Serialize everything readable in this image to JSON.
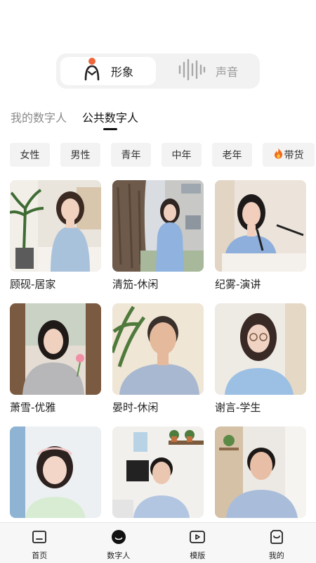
{
  "segment": {
    "image_label": "形象",
    "voice_label": "声音"
  },
  "tabs": [
    {
      "label": "我的数字人",
      "active": false
    },
    {
      "label": "公共数字人",
      "active": true
    }
  ],
  "filters": [
    {
      "label": "女性"
    },
    {
      "label": "男性"
    },
    {
      "label": "青年"
    },
    {
      "label": "中年"
    },
    {
      "label": "老年"
    },
    {
      "label": "带货",
      "icon": "fire-icon"
    }
  ],
  "cards": [
    {
      "label": "顾砚-居家"
    },
    {
      "label": "清笳-休闲"
    },
    {
      "label": "纪雾-演讲"
    },
    {
      "label": "萧雪-优雅"
    },
    {
      "label": "晏时-休闲"
    },
    {
      "label": "谢言-学生"
    },
    {
      "label": ""
    },
    {
      "label": ""
    },
    {
      "label": ""
    }
  ],
  "nav": [
    {
      "label": "首页",
      "icon": "home-icon"
    },
    {
      "label": "数字人",
      "icon": "digital-human-icon",
      "active": true
    },
    {
      "label": "模版",
      "icon": "template-icon"
    },
    {
      "label": "我的",
      "icon": "profile-icon"
    }
  ],
  "colors": {
    "accent_orange": "#f0663c",
    "active_text": "#111111",
    "inactive_text": "#8a8a8a"
  }
}
